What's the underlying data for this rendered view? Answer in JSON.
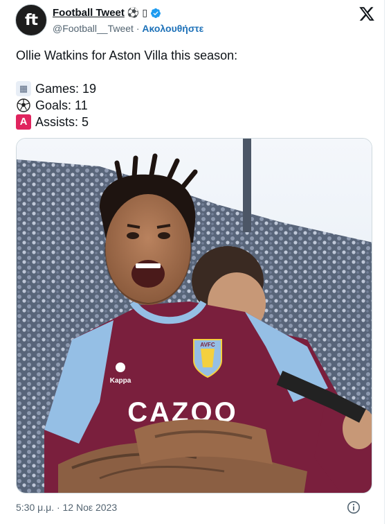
{
  "author": {
    "name": "Football Tweet",
    "name_emoji": "⚽",
    "name_emoji_fallback": "▯",
    "avatar_text": "ft",
    "handle": "@Football__Tweet",
    "separator": "·",
    "follow_label": "Ακολουθήστε"
  },
  "tweet": {
    "headline": "Ollie Watkins for Aston Villa this season:",
    "stats": [
      {
        "icon": "stadium-icon",
        "label": "Games: 19"
      },
      {
        "icon": "soccer-ball-icon",
        "label": "Goals: 11"
      },
      {
        "icon": "letter-a-icon",
        "label": "Assists: 5"
      }
    ],
    "photo_alt": "Ollie Watkins celebrating in Aston Villa kit",
    "kit_crest": "AVFC",
    "kit_sponsor": "CAZOO"
  },
  "footer": {
    "time": "5:30 μ.μ.",
    "separator": "·",
    "date": "12 Νοε 2023"
  },
  "colors": {
    "verified": "#1d9bf0",
    "follow": "#1d71b8",
    "assist_badge": "#e0245e",
    "claret": "#7a1f3d",
    "sky_blue": "#95bfe5"
  }
}
